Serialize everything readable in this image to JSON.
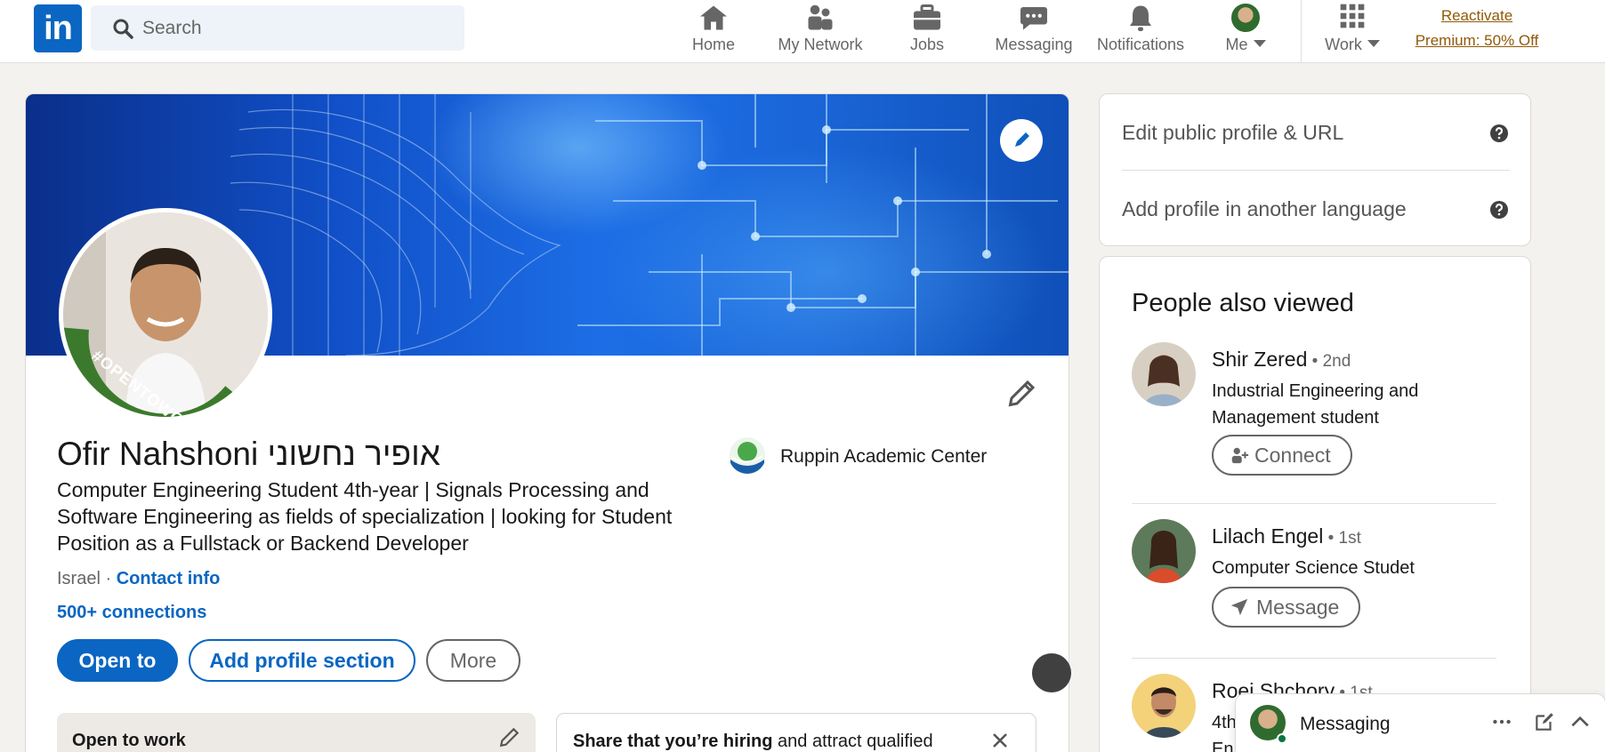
{
  "nav": {
    "logo_text": "in",
    "search_placeholder": "Search",
    "items": [
      {
        "label": "Home",
        "icon": "home-icon"
      },
      {
        "label": "My Network",
        "icon": "network-icon"
      },
      {
        "label": "Jobs",
        "icon": "briefcase-icon"
      },
      {
        "label": "Messaging",
        "icon": "chat-icon"
      },
      {
        "label": "Notifications",
        "icon": "bell-icon"
      },
      {
        "label": "Me",
        "icon": "avatar"
      },
      {
        "label": "Work",
        "icon": "grid-icon"
      }
    ],
    "premium_line1": "Reactivate",
    "premium_line2": "Premium: 50% Off"
  },
  "profile": {
    "name": "Ofir Nahshoni אופיר נחשוני",
    "headline": "Computer Engineering Student 4th-year | Signals Processing and Software Engineering as fields of specialization | looking for Student Position as a Fullstack or Backend Developer",
    "location": "Israel",
    "location_sep": " · ",
    "contact_info": "Contact info",
    "connections": "500+ connections",
    "open_to_work_badge": "#OPENTOWORK",
    "organization": "Ruppin Academic Center",
    "buttons": {
      "open_to": "Open to",
      "add_section": "Add profile section",
      "more": "More"
    },
    "open_to_work_card": "Open to work",
    "hiring_card_bold": "Share that you’re hiring",
    "hiring_card_rest": " and attract qualified"
  },
  "sidebar": {
    "edit_url": "Edit public profile & URL",
    "add_language": "Add profile in another language",
    "people_heading": "People also viewed",
    "people": [
      {
        "name": "Shir Zered",
        "degree": " • 2nd",
        "title": "Industrial Engineering and Management student",
        "action": "Connect"
      },
      {
        "name": "Lilach Engel",
        "degree": " • 1st",
        "title": "Computer Science Studet",
        "action": "Message"
      },
      {
        "name": "Roei Shchory",
        "degree": " • 1st",
        "title": "4th",
        "title2": "En"
      }
    ]
  },
  "messaging": {
    "label": "Messaging"
  },
  "colors": {
    "brand": "#0a66c2",
    "premium": "#915907",
    "open_to_work_green": "#2f6b2f",
    "online": "#057642"
  }
}
